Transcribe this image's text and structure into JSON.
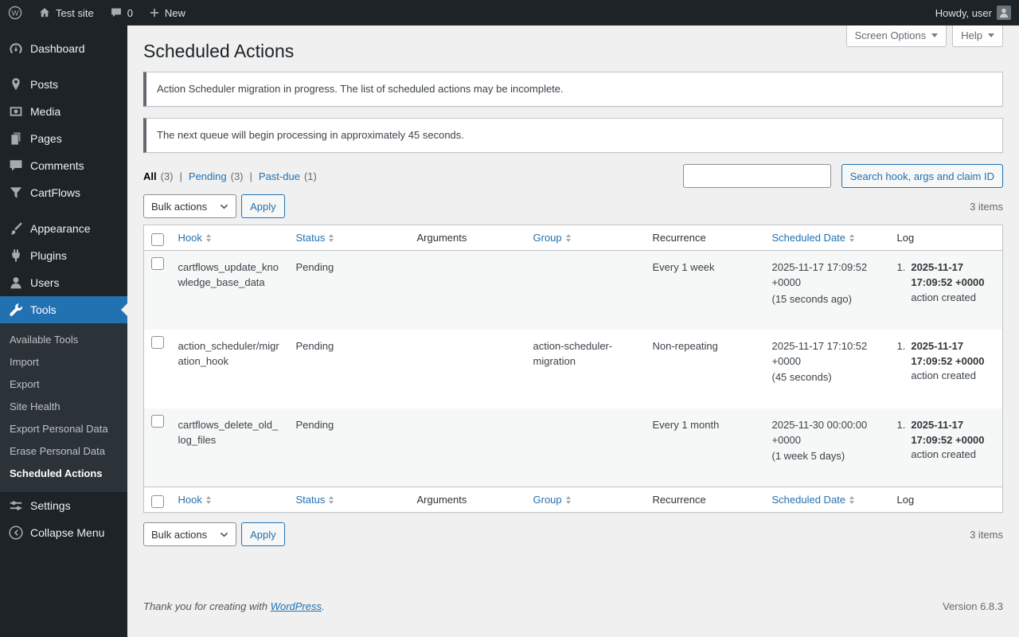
{
  "admin_bar": {
    "site_name": "Test site",
    "comments_count": "0",
    "new_label": "New",
    "howdy": "Howdy, user"
  },
  "sidebar": {
    "items": [
      {
        "label": "Dashboard"
      },
      {
        "label": "Posts"
      },
      {
        "label": "Media"
      },
      {
        "label": "Pages"
      },
      {
        "label": "Comments"
      },
      {
        "label": "CartFlows"
      },
      {
        "label": "Appearance"
      },
      {
        "label": "Plugins"
      },
      {
        "label": "Users"
      },
      {
        "label": "Tools"
      },
      {
        "label": "Settings"
      },
      {
        "label": "Collapse Menu"
      }
    ],
    "tools_submenu": [
      {
        "label": "Available Tools"
      },
      {
        "label": "Import"
      },
      {
        "label": "Export"
      },
      {
        "label": "Site Health"
      },
      {
        "label": "Export Personal Data"
      },
      {
        "label": "Erase Personal Data"
      },
      {
        "label": "Scheduled Actions"
      }
    ]
  },
  "page": {
    "title": "Scheduled Actions",
    "screen_options_label": "Screen Options",
    "help_label": "Help"
  },
  "notices": {
    "migration": "Action Scheduler migration in progress. The list of scheduled actions may be incomplete.",
    "queue": "The next queue will begin processing in approximately 45 seconds."
  },
  "filters": {
    "all_label": "All",
    "all_count": "(3)",
    "pending_label": "Pending",
    "pending_count": "(3)",
    "pastdue_label": "Past-due",
    "pastdue_count": "(1)",
    "separator": "|"
  },
  "search": {
    "button_label": "Search hook, args and claim ID"
  },
  "tablenav": {
    "bulk_actions_label": "Bulk actions",
    "apply_label": "Apply",
    "items_count": "3 items"
  },
  "table": {
    "headers": {
      "hook": "Hook",
      "status": "Status",
      "arguments": "Arguments",
      "group": "Group",
      "recurrence": "Recurrence",
      "scheduled_date": "Scheduled Date",
      "log": "Log"
    },
    "rows": [
      {
        "hook": "cartflows_update_knowledge_base_data",
        "status": "Pending",
        "arguments": "",
        "group": "",
        "recurrence": "Every 1 week",
        "scheduled_date": "2025-11-17 17:09:52 +0000",
        "scheduled_relative": "(15 seconds ago)",
        "log_index": "1.",
        "log_date": "2025-11-17 17:09:52 +0000",
        "log_text": "action created"
      },
      {
        "hook": "action_scheduler/migration_hook",
        "status": "Pending",
        "arguments": "",
        "group": "action-scheduler-migration",
        "recurrence": "Non-repeating",
        "scheduled_date": "2025-11-17 17:10:52 +0000",
        "scheduled_relative": "(45 seconds)",
        "log_index": "1.",
        "log_date": "2025-11-17 17:09:52 +0000",
        "log_text": "action created"
      },
      {
        "hook": "cartflows_delete_old_log_files",
        "status": "Pending",
        "arguments": "",
        "group": "",
        "recurrence": "Every 1 month",
        "scheduled_date": "2025-11-30 00:00:00 +0000",
        "scheduled_relative": "(1 week 5 days)",
        "log_index": "1.",
        "log_date": "2025-11-17 17:09:52 +0000",
        "log_text": "action created"
      }
    ]
  },
  "footer": {
    "thanks": "Thank you for creating with",
    "wordpress_link": "WordPress",
    "period": ".",
    "version": "Version 6.8.3"
  },
  "colors": {
    "admin_bar_bg": "#1d2327",
    "submenu_bg": "#2c3338",
    "accent_blue": "#2271b1",
    "content_bg": "#f0f0f1",
    "notice_border": "#646970"
  }
}
